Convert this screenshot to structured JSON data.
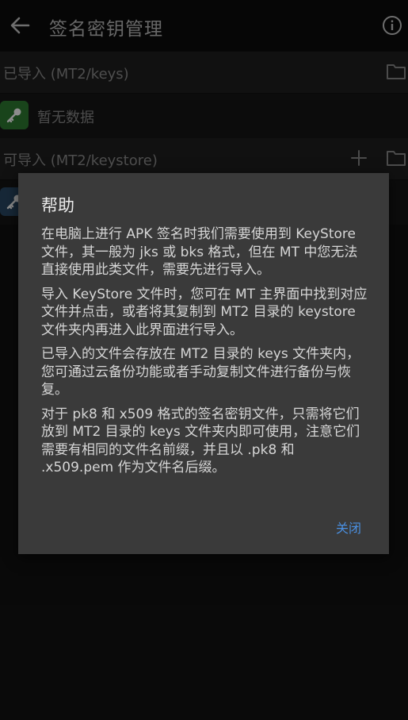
{
  "appbar": {
    "title": "签名密钥管理"
  },
  "sections": {
    "imported_label": "已导入 (MT2/keys)",
    "empty_text": "暂无数据",
    "importable_label": "可导入 (MT2/keystore)"
  },
  "dialog": {
    "title": "帮助",
    "paragraphs": [
      "在电脑上进行 APK 签名时我们需要使用到 KeyStore 文件，其一般为 jks 或 bks 格式，但在 MT 中您无法直接使用此类文件，需要先进行导入。",
      "导入 KeyStore 文件时，您可在 MT 主界面中找到对应文件并点击，或者将其复制到 MT2 目录的 keystore 文件夹内再进入此界面进行导入。",
      "已导入的文件会存放在 MT2 目录的 keys 文件夹内，您可通过云备份功能或者手动复制文件进行备份与恢复。",
      "对于 pk8 和 x509 格式的签名密钥文件，只需将它们放到 MT2 目录的 keys 文件夹内即可使用，注意它们需要有相同的文件名前缀，并且以 .pk8 和 .x509.pem 作为文件名后缀。"
    ],
    "close_label": "关闭"
  },
  "colors": {
    "accent": "#4a8fe0",
    "key_badge": "#2e7d32"
  }
}
